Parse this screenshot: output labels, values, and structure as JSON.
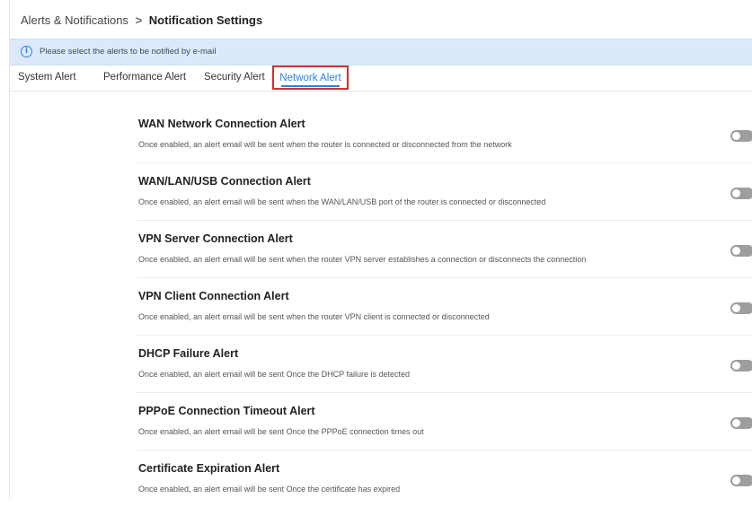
{
  "breadcrumb": {
    "parent": "Alerts & Notifications",
    "separator": ">",
    "current": "Notification Settings"
  },
  "info": {
    "icon": "info-icon",
    "glyph": "i",
    "text": "Please select the alerts to be notified by e-mail"
  },
  "tabs": [
    {
      "label": "System Alert",
      "active": false
    },
    {
      "label": "Performance Alert",
      "active": false
    },
    {
      "label": "Security Alert",
      "active": false
    },
    {
      "label": "Network Alert",
      "active": true
    }
  ],
  "colors": {
    "accent": "#2f7fe5",
    "highlight": "#d32f2f",
    "toggle_off": "#9e9e9e",
    "info_bg": "#dce9fb"
  },
  "alerts": [
    {
      "title": "WAN Network Connection Alert",
      "description": "Once enabled, an alert email will be sent when the router is connected or disconnected from the network",
      "enabled": false
    },
    {
      "title": "WAN/LAN/USB Connection Alert",
      "description": "Once enabled, an alert email will be sent when the WAN/LAN/USB port of the router is connected or disconnected",
      "enabled": false
    },
    {
      "title": "VPN Server Connection Alert",
      "description": "Once enabled, an alert email will be sent when the router VPN server establishes a connection or disconnects the connection",
      "enabled": false
    },
    {
      "title": "VPN Client Connection Alert",
      "description": "Once enabled, an alert email will be sent when the router VPN client is connected or disconnected",
      "enabled": false
    },
    {
      "title": "DHCP Failure Alert",
      "description": "Once enabled, an alert email will be sent Once the DHCP failure is detected",
      "enabled": false
    },
    {
      "title": "PPPoE Connection Timeout Alert",
      "description": "Once enabled, an alert email will be sent Once the PPPoE connection times out",
      "enabled": false
    },
    {
      "title": "Certificate Expiration Alert",
      "description": "Once enabled, an alert email will be sent Once the certificate has expired",
      "enabled": false
    }
  ]
}
